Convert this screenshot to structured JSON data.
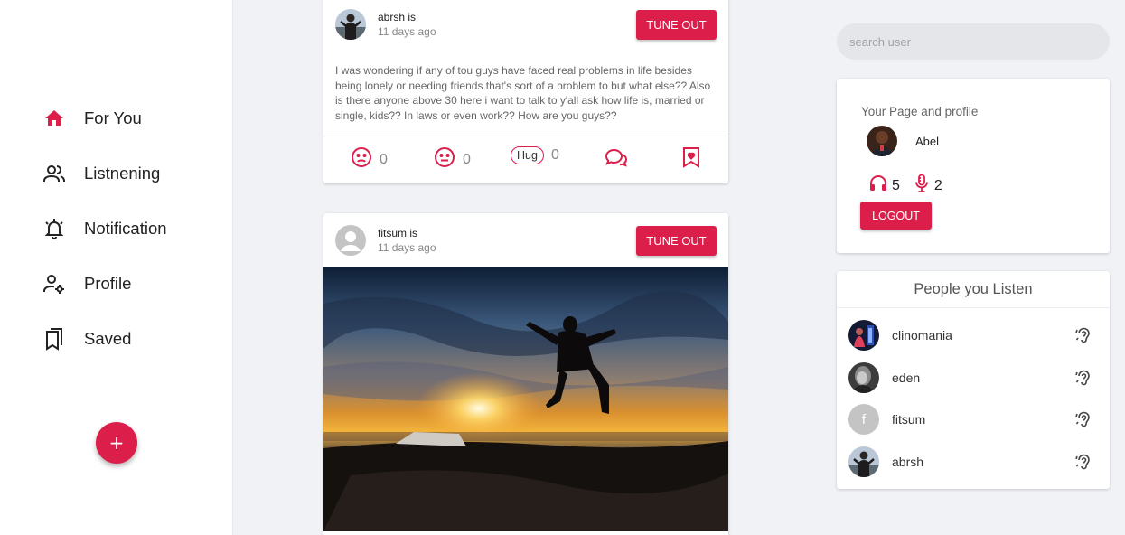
{
  "nav": {
    "items": [
      {
        "label": "For You",
        "icon": "home-icon"
      },
      {
        "label": "Listnening",
        "icon": "people-icon"
      },
      {
        "label": "Notification",
        "icon": "bell-icon"
      },
      {
        "label": "Profile",
        "icon": "user-settings-icon"
      },
      {
        "label": "Saved",
        "icon": "bookmarks-icon"
      }
    ],
    "fab_label": "+"
  },
  "posts": [
    {
      "author": "abrsh is",
      "time": "11 days ago",
      "tune_out": "TUNE OUT",
      "body": "I was wondering if any of tou guys have faced real problems in life besides being lonely or needing friends that's sort of a problem to but what else?? Also is there anyone above 30 here i want to talk to y'all ask how life is, married or single, kids?? In laws or even work?? How are you guys??",
      "reactions": {
        "sad": "0",
        "meh": "0",
        "hug_label": "Hug",
        "hug": "0"
      }
    },
    {
      "author": "fitsum is",
      "time": "11 days ago",
      "tune_out": "TUNE OUT"
    }
  ],
  "search": {
    "placeholder": "search user"
  },
  "profile": {
    "heading": "Your Page and profile",
    "name": "Abel",
    "listeners": "5",
    "speakers": "2",
    "logout": "LOGOUT"
  },
  "people": {
    "title": "People you Listen",
    "list": [
      {
        "name": "clinomania"
      },
      {
        "name": "eden"
      },
      {
        "name": "fitsum",
        "initial": "f"
      },
      {
        "name": "abrsh"
      }
    ]
  },
  "colors": {
    "accent": "#dc1e4b",
    "background": "#f0f2f5"
  }
}
